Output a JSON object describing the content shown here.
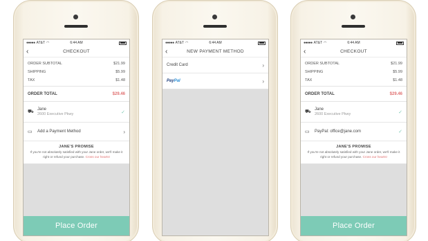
{
  "status": {
    "carrier": "AT&T",
    "signal_dots": "●●●●●",
    "wifi": "◠",
    "time": "6:44 AM"
  },
  "checkout": {
    "title": "CHECKOUT",
    "summary": [
      {
        "label": "ORDER SUBTOTAL",
        "value": "$21.99"
      },
      {
        "label": "SHIPPING",
        "value": "$5.99"
      },
      {
        "label": "TAX",
        "value": "$1.48"
      }
    ],
    "total_label": "ORDER TOTAL",
    "total_value": "$29.46",
    "shipping_name": "Jane",
    "shipping_address": "2600 Executive Pkwy",
    "add_payment_label": "Add a Payment Method",
    "paypal_selected_label": "PayPal: office@jane.com",
    "promise_title": "JANE'S PROMISE",
    "promise_text": "If you're not absolutely satisfied with your Jane order, we'll make it right or refund your purchase.",
    "promise_hearts": "Cross our hearts!",
    "place_order": "Place Order"
  },
  "payment": {
    "title": "NEW PAYMENT METHOD",
    "options": [
      {
        "label": "Credit Card"
      },
      {
        "label": "PayPal"
      }
    ],
    "paypal_part1": "Pay",
    "paypal_part2": "Pal"
  },
  "icons": {
    "back": "‹",
    "chevron": "›",
    "check": "✓",
    "truck": "🚚",
    "card": "▭"
  }
}
